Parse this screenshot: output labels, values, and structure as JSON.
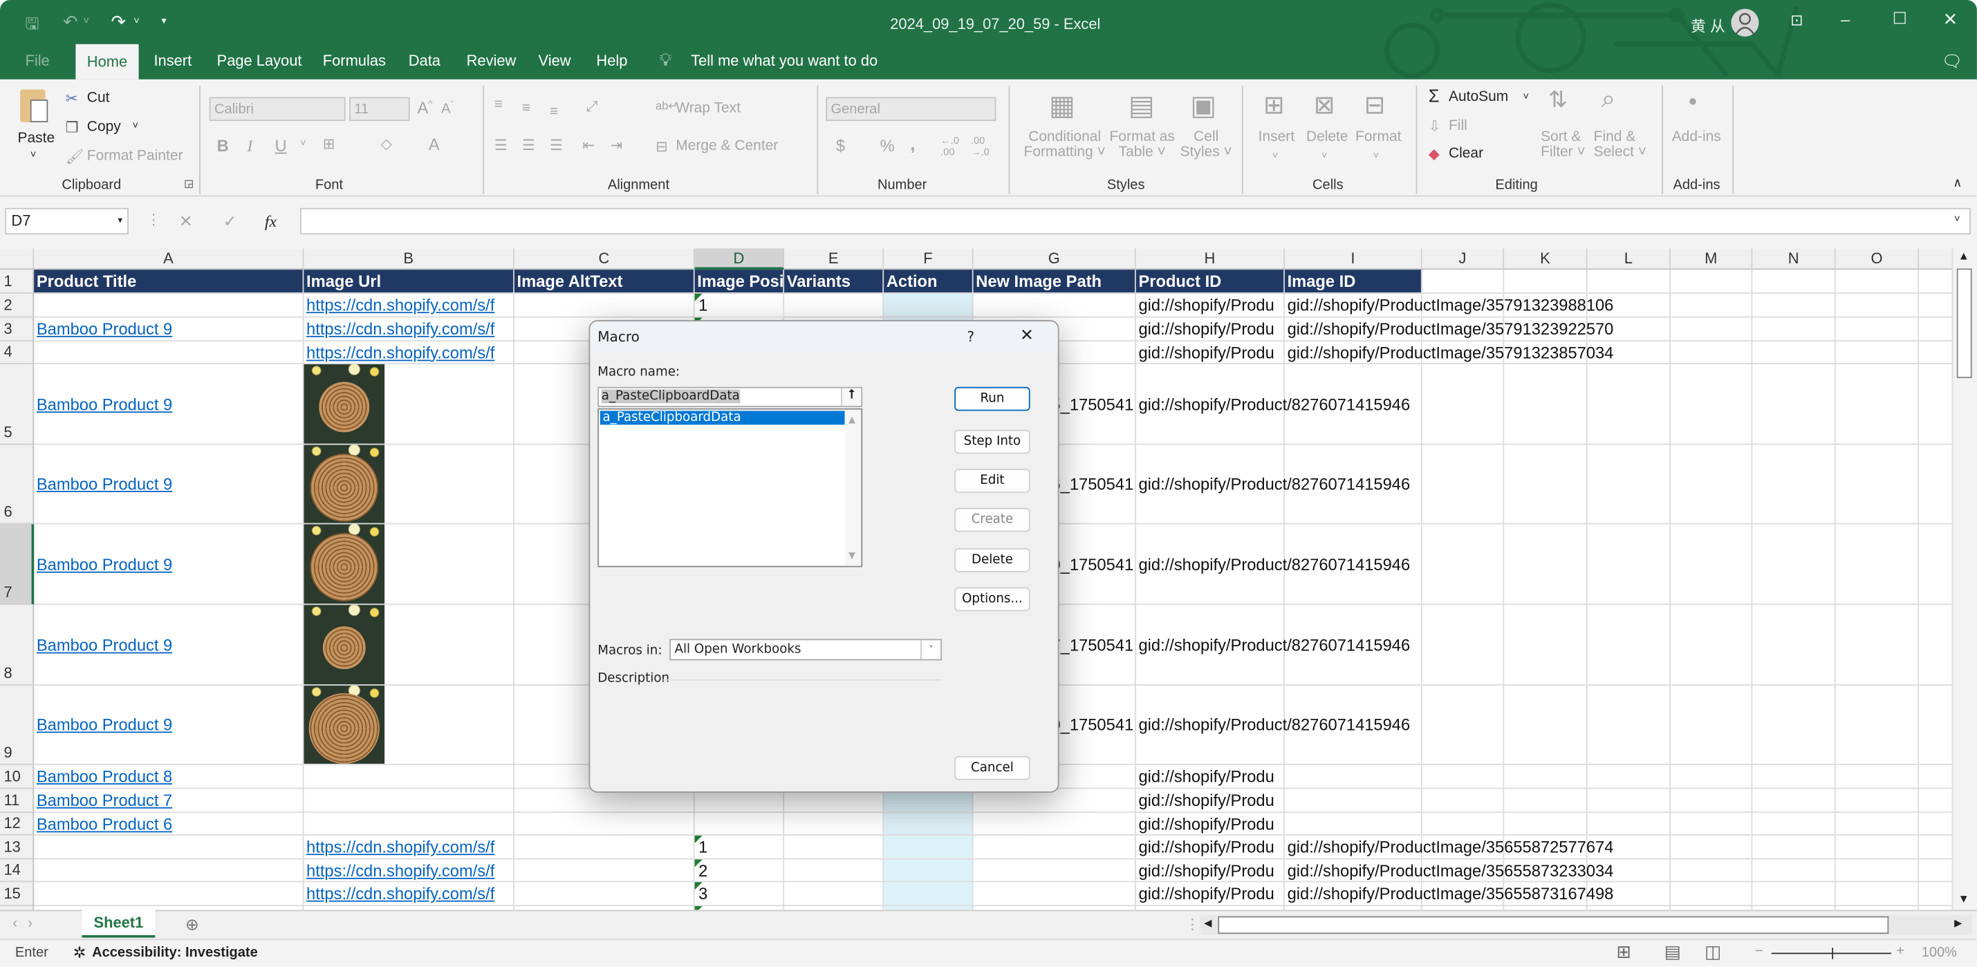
{
  "window": {
    "title": "2024_09_19_07_20_59  -  Excel",
    "user_name": "黄 从"
  },
  "quick_access": {
    "icons": [
      "save-icon",
      "undo-icon",
      "redo-icon",
      "customize-icon"
    ]
  },
  "tabs": [
    "File",
    "Home",
    "Insert",
    "Page Layout",
    "Formulas",
    "Data",
    "Review",
    "View",
    "Help"
  ],
  "tell_me": "Tell me what you want to do",
  "ribbon": {
    "clipboard": {
      "paste": "Paste",
      "cut": "Cut",
      "copy": "Copy",
      "format_painter": "Format Painter",
      "label": "Clipboard"
    },
    "font": {
      "font_name": "Calibri",
      "font_size": "11",
      "bold": "B",
      "italic": "I",
      "underline": "U",
      "label": "Font"
    },
    "alignment": {
      "wrap_text": "Wrap Text",
      "merge_center": "Merge & Center",
      "label": "Alignment"
    },
    "number": {
      "format": "General",
      "currency": "$",
      "percent": "%",
      "comma": ",",
      "label": "Number"
    },
    "styles": {
      "conditional": [
        "Conditional",
        "Formatting"
      ],
      "format_table": [
        "Format as",
        "Table"
      ],
      "cell_styles": [
        "Cell",
        "Styles"
      ],
      "label": "Styles"
    },
    "cells": {
      "insert": "Insert",
      "delete": "Delete",
      "format": "Format",
      "label": "Cells"
    },
    "editing": {
      "autosum": "AutoSum",
      "fill": "Fill",
      "clear": "Clear",
      "sort": [
        "Sort &",
        "Filter"
      ],
      "find": [
        "Find &",
        "Select"
      ],
      "label": "Editing"
    },
    "addins": {
      "addins": "Add-ins",
      "label": "Add-ins"
    }
  },
  "formula_bar": {
    "name_box": "D7",
    "formula": "",
    "fx": "fx"
  },
  "sheet": {
    "columns": [
      "A",
      "B",
      "C",
      "D",
      "E",
      "F",
      "G",
      "H",
      "I",
      "J",
      "K",
      "L",
      "M",
      "N",
      "O",
      ""
    ],
    "selected_column": "D",
    "selected_row": 7,
    "highlight_color": "#ddf2f8",
    "header_color": "#203864",
    "rows": [
      {
        "n": "1",
        "header": true,
        "cells": {
          "A": "Product Title",
          "B": "Image Url",
          "C": "Image AltText",
          "D": "Image Posit",
          "E": "Variants",
          "F": "Action",
          "G": "New Image Path",
          "H": "Product ID",
          "I": "Image ID"
        }
      },
      {
        "n": "2",
        "cells": {
          "B": "https://cdn.shopify.com/s/f",
          "D": "1",
          "H": "gid://shopify/Produ",
          "I": "gid://shopify/ProductImage/35791323988106"
        }
      },
      {
        "n": "3",
        "cells": {
          "A": "Bamboo Product 9",
          "B": "https://cdn.shopify.com/s/f",
          "H": "gid://shopify/Produ",
          "I": "gid://shopify/ProductImage/35791323922570"
        }
      },
      {
        "n": "4",
        "cells": {
          "B": "https://cdn.shopify.com/s/f",
          "H": "gid://shopify/Produ",
          "I": "gid://shopify/ProductImage/35791323857034"
        }
      },
      {
        "n": "5",
        "image": true,
        "cells": {
          "A": "Bamboo Product 9",
          "G": "5_1750541",
          "H": "gid://shopify/Product/8276071415946"
        }
      },
      {
        "n": "6",
        "image": true,
        "cells": {
          "A": "Bamboo Product 9",
          "G": "6_1750541",
          "H": "gid://shopify/Product/8276071415946"
        }
      },
      {
        "n": "7",
        "image": true,
        "cells": {
          "A": "Bamboo Product 9",
          "G": "0_1750541",
          "H": "gid://shopify/Product/8276071415946"
        }
      },
      {
        "n": "8",
        "image": true,
        "cells": {
          "A": "Bamboo Product 9",
          "G": "7_1750541",
          "H": "gid://shopify/Product/8276071415946"
        }
      },
      {
        "n": "9",
        "image": true,
        "cells": {
          "A": "Bamboo Product 9",
          "G": "0_1750541",
          "H": "gid://shopify/Product/8276071415946"
        }
      },
      {
        "n": "10",
        "cells": {
          "A": "Bamboo Product 8",
          "H": "gid://shopify/Produ"
        }
      },
      {
        "n": "11",
        "cells": {
          "A": "Bamboo Product 7",
          "H": "gid://shopify/Produ"
        }
      },
      {
        "n": "12",
        "cells": {
          "A": "Bamboo Product 6",
          "H": "gid://shopify/Produ"
        }
      },
      {
        "n": "13",
        "cells": {
          "B": "https://cdn.shopify.com/s/f",
          "D": "1",
          "H": "gid://shopify/Produ",
          "I": "gid://shopify/ProductImage/35655872577674"
        }
      },
      {
        "n": "14",
        "cells": {
          "B": "https://cdn.shopify.com/s/f",
          "D": "2",
          "H": "gid://shopify/Produ",
          "I": "gid://shopify/ProductImage/35655873233034"
        }
      },
      {
        "n": "15",
        "cells": {
          "B": "https://cdn.shopify.com/s/f",
          "D": "3",
          "H": "gid://shopify/Produ",
          "I": "gid://shopify/ProductImage/35655873167498"
        }
      },
      {
        "n": "16",
        "cells": {}
      }
    ],
    "tabs": [
      "Sheet1"
    ]
  },
  "dialog": {
    "title": "Macro",
    "help": "?",
    "macro_name_label": "Macro name:",
    "macro_name_value": "a_PasteClipboardData",
    "macro_list": [
      "a_PasteClipboardData"
    ],
    "buttons": {
      "run": "Run",
      "step_into": "Step Into",
      "edit": "Edit",
      "create": "Create",
      "delete": "Delete",
      "options": "Options...",
      "cancel": "Cancel"
    },
    "macros_in_label": "Macros in:",
    "macros_in_value": "All Open Workbooks",
    "description_label": "Description"
  },
  "status_bar": {
    "mode": "Enter",
    "accessibility": "Accessibility: Investigate",
    "zoom": "100%",
    "zoom_level_percent": 100
  }
}
